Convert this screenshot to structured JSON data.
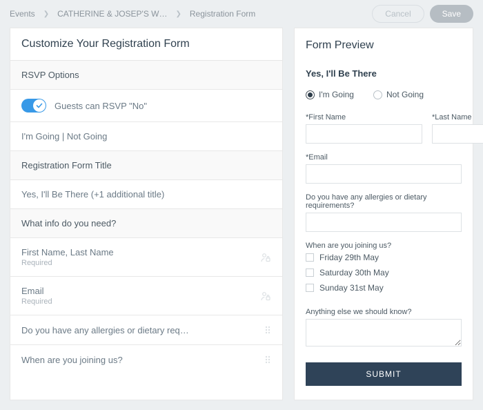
{
  "breadcrumbs": {
    "item0": "Events",
    "item1": "CATHERINE & JOSEP'S W…",
    "item2": "Registration Form"
  },
  "actions": {
    "cancel": "Cancel",
    "save": "Save"
  },
  "editor": {
    "page_title": "Customize Your Registration Form",
    "rsvp_section": "RSVP Options",
    "toggle_label": "Guests can RSVP \"No\"",
    "toggle_on": true,
    "status_labels": "I'm Going | Not Going",
    "form_title_section": "Registration Form Title",
    "form_title_value": "Yes, I'll Be There (+1 additional title)",
    "info_section": "What info do you need?",
    "fields": [
      {
        "label": "First Name, Last Name",
        "sub": "Required",
        "icon": "person-lock-icon"
      },
      {
        "label": "Email",
        "sub": "Required",
        "icon": "person-lock-icon"
      },
      {
        "label": "Do you have any allergies or dietary req…",
        "sub": null,
        "icon": "drag-handle-icon"
      },
      {
        "label": "When are you joining us?",
        "sub": null,
        "icon": "drag-handle-icon"
      }
    ]
  },
  "preview": {
    "heading": "Form Preview",
    "status_heading": "Yes, I'll Be There",
    "radios": {
      "going": "I'm Going",
      "not_going": "Not Going",
      "selected": "going"
    },
    "first_name_label": "*First Name",
    "last_name_label": "*Last Name",
    "email_label": "*Email",
    "allergies_label": "Do you have any allergies or dietary requirements?",
    "joining_label": "When are you joining us?",
    "joining_options": {
      "o0": "Friday 29th May",
      "o1": "Saturday 30th May",
      "o2": "Sunday 31st May"
    },
    "anything_label": "Anything else we should know?",
    "submit": "SUBMIT"
  }
}
